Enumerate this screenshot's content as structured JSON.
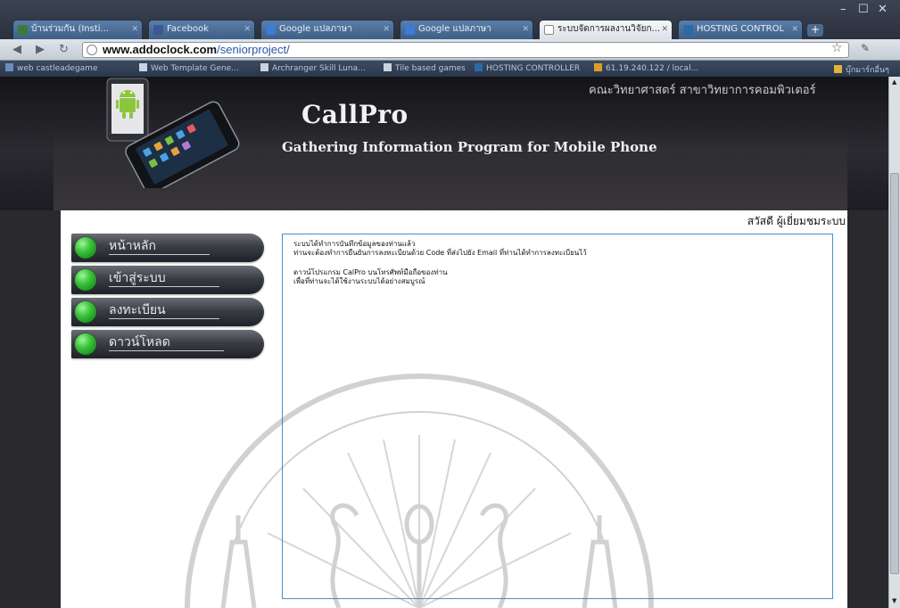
{
  "browser": {
    "tabs": [
      {
        "label": "บ้านร่วมกัน (Insti...",
        "active": false,
        "color": "#3a7a3a"
      },
      {
        "label": "Facebook",
        "active": false,
        "color": "#3b5998"
      },
      {
        "label": "Google แปลภาษา",
        "active": false,
        "color": "#3d7bd6"
      },
      {
        "label": "Google แปลภาษา",
        "active": false,
        "color": "#3d7bd6"
      },
      {
        "label": "ระบบจัดการผลงานวิจัยก...",
        "active": true,
        "color": "#ffffff"
      },
      {
        "label": "HOSTING CONTROL",
        "active": false,
        "color": "#2a6aa8"
      }
    ],
    "url_host": "www.addoclock.com",
    "url_path": "/seniorproject/",
    "bookmarks": [
      "web castleadegame",
      "Web Template Gene...",
      "Archranger Skill Luna...",
      "Tile based games",
      "HOSTING CONTROLLER",
      "61.19.240.122 / local...",
      "บุ๊กมาร์กอื่นๆ"
    ]
  },
  "header": {
    "faculty": "คณะวิทยาศาสตร์ สาขาวิทยาการคอมพิวเตอร์",
    "title": "CallPro",
    "subtitle": "Gathering Information Program for Mobile Phone"
  },
  "welcome": "สวัสดี ผู้เยี่ยมชมระบบ",
  "menu": [
    {
      "label": "หน้าหลัก"
    },
    {
      "label": "เข้าสู่ระบบ"
    },
    {
      "label": "ลงทะเบียน"
    },
    {
      "label": "ดาวน์โหลด"
    }
  ],
  "message": {
    "line1": "ระบบได้ทำการบันทึกข้อมูลของท่านแล้ว",
    "line2": "ท่านจะต้องทำการยืนยันการลงทะเบียนด้วย Code ที่ส่งไปยัง Email ที่ท่านได้ทำการลงทะเบียนไว้",
    "line3": "ดาวน์โปรแกรม CalPro บนโทรศัพท์มือถือของท่าน",
    "line4": "เพื่อที่ท่านจะได้ใช้งานระบบได้อย่างสมบูรณ์"
  },
  "colors": {
    "accent_green": "#3bc43a",
    "message_border": "#4a8fc2",
    "header_bg": "#1c1c22"
  }
}
